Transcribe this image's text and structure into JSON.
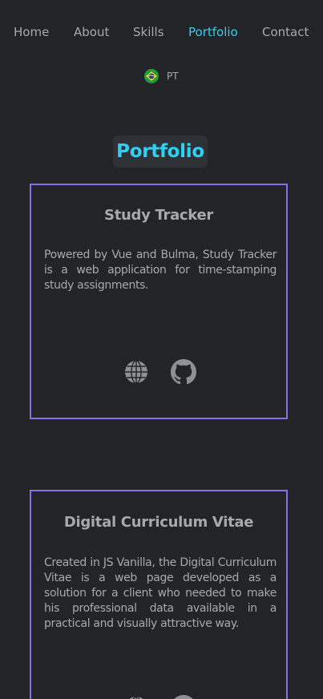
{
  "nav": {
    "items": [
      {
        "label": "Home",
        "active": false
      },
      {
        "label": "About",
        "active": false
      },
      {
        "label": "Skills",
        "active": false
      },
      {
        "label": "Portfolio",
        "active": true
      },
      {
        "label": "Contact",
        "active": false
      }
    ],
    "active_color": "#2fd1f2",
    "text_color": "#a7a9ad"
  },
  "language": {
    "label": "PT",
    "flag_icon": "brazil-flag-icon"
  },
  "portfolio": {
    "title": "Portfolio",
    "title_color": "#2fd1f2",
    "card_border_color": "#8b6ee8",
    "projects": [
      {
        "title": "Study Tracker",
        "description": "Powered by Vue and Bulma, Study Tracker is a web application for time-stamping study assignments.",
        "links": [
          {
            "icon": "globe-icon"
          },
          {
            "icon": "github-icon"
          }
        ]
      },
      {
        "title": "Digital Curriculum Vitae",
        "description": "Created in JS Vanilla, the Digital Curriculum Vitae is a web page developed as a solution for a client who needed to make his professional data available in a practical and visually attractive way.",
        "links": [
          {
            "icon": "globe-icon"
          },
          {
            "icon": "github-icon"
          }
        ]
      }
    ]
  },
  "background_color": "#222428"
}
